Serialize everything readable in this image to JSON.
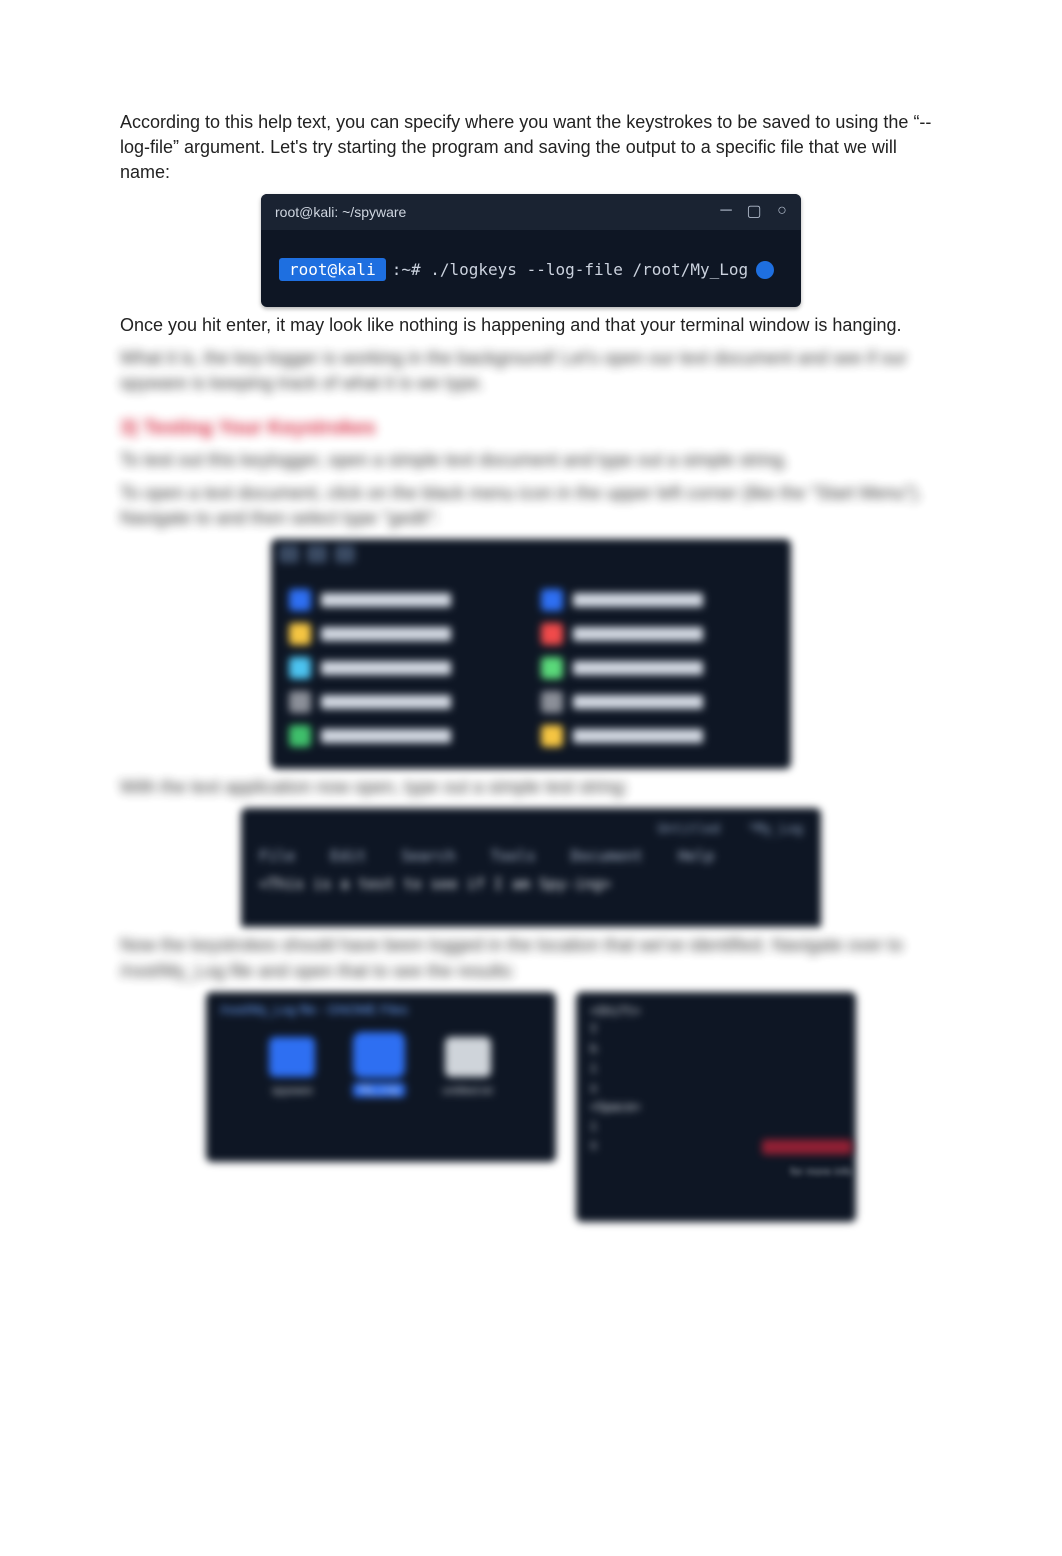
{
  "paragraphs": {
    "p1": "According to this help text, you can specify where you want the keystrokes to be saved to using the “--log-file” argument. Let's try starting the program and saving the output to a specific file that we will name:",
    "p2": "Once you hit enter, it may look like nothing is happening and that your terminal window is hanging.",
    "p3_blur": "What it is, the key-logger is working in the background! Let's open our text document and see if our spyware is keeping track of what it is we type.",
    "p4_blur": "To test out this keylogger, open a simple text document and type out a simple string.",
    "p5_blur": "To open a text document, click on the black menu icon in the upper left corner (like the \"Start Menu\"). Navigate to and then select type \"gedit\":",
    "p6_blur": "With the text application now open, type out a simple test string:",
    "p7_blur": "Now the keystrokes should have been logged in the location that we've identified. Navigate over to /root/My_Log file and open that to see the results:"
  },
  "heading": "3) Testing Your Keystrokes",
  "terminal1": {
    "title": "root@kali: ~/spyware",
    "prompt": "root@kali",
    "rest": ":~# ./logkeys --log-file /root/My_Log"
  },
  "menu": {
    "left": [
      "Favorites",
      "Recently Used",
      "All Applications",
      "Settings",
      "Usual Applications"
    ],
    "right": [
      "E-ImageMagick",
      "K-Leafpad",
      "L-LibreOffice",
      "S-screenshot",
      "gedit"
    ],
    "left_colors": [
      "#2e6ff2",
      "#f5c542",
      "#4cc3f0",
      "#8b8f98",
      "#3fbf6b"
    ],
    "right_colors": [
      "#2e6ff2",
      "#f04a4a",
      "#5ad97a",
      "#8b8f98",
      "#f5c542"
    ]
  },
  "editor": {
    "tabs": [
      "Untitled",
      "*My_Log"
    ],
    "menu": [
      "File",
      "Edit",
      "Search",
      "Tools",
      "Document",
      "Help"
    ],
    "line": "<This is a test to see if I am Spy-ing>"
  },
  "folder": {
    "title": "/root/My_Log file  -  GNOME Files",
    "items": [
      {
        "label": "spyware",
        "type": "folder"
      },
      {
        "label": "My_Log",
        "type": "file-selected"
      },
      {
        "label": "untitled.txt",
        "type": "file"
      }
    ]
  },
  "log": {
    "lines": [
      "<Shift>",
      "T",
      "h",
      "i",
      "s",
      "<Space>",
      "i",
      "s"
    ]
  },
  "watermark_sub": "for more info"
}
